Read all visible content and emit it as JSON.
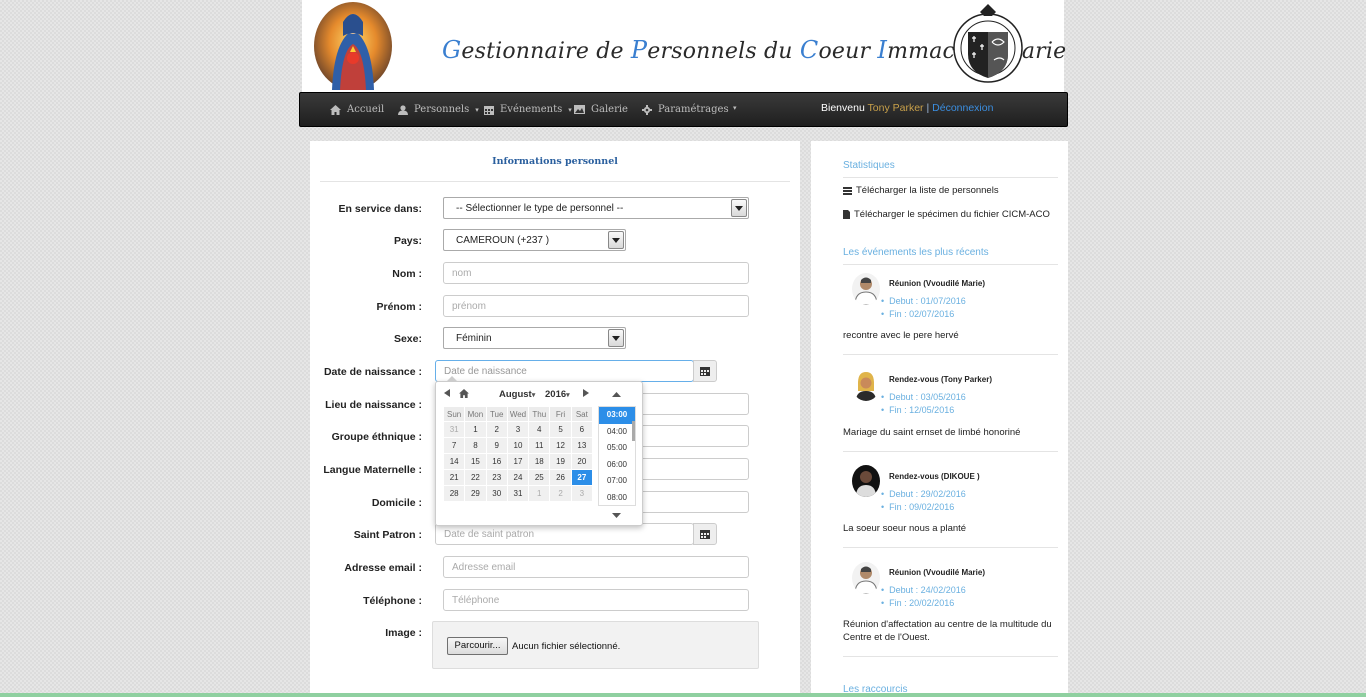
{
  "header": {
    "title_parts": [
      {
        "cap": "G",
        "rest": "estionnaire de "
      },
      {
        "cap": "P",
        "rest": "ersonnels du "
      },
      {
        "cap": "C",
        "rest": "oeur "
      },
      {
        "cap": "I",
        "rest": "mmaculé "
      },
      {
        "cap": "M",
        "rest": "arie"
      }
    ]
  },
  "nav": {
    "items": [
      {
        "label": "Accueil",
        "icon": "home-icon",
        "dropdown": false
      },
      {
        "label": "Personnels",
        "icon": "user-icon",
        "dropdown": true
      },
      {
        "label": "Evénements",
        "icon": "calendar-icon",
        "dropdown": true
      },
      {
        "label": "Galerie",
        "icon": "picture-icon",
        "dropdown": false
      },
      {
        "label": "Paramétrages",
        "icon": "gear-icon",
        "dropdown": false
      }
    ],
    "welcome": "Bienvenu",
    "user": "Tony Parker",
    "separator": "|",
    "logout": "Déconnexion"
  },
  "form": {
    "title": "Informations personnel",
    "fields": {
      "service_label": "En service dans:",
      "service_value": "-- Sélectionner le type de personnel --",
      "pays_label": "Pays:",
      "pays_value": "CAMEROUN (+237 )",
      "nom_label": "Nom :",
      "nom_placeholder": "nom",
      "prenom_label": "Prénom :",
      "prenom_placeholder": "prénom",
      "sexe_label": "Sexe:",
      "sexe_value": "Féminin",
      "naissance_label": "Date de naissance :",
      "naissance_placeholder": "Date de naissance",
      "lieu_label": "Lieu de naissance :",
      "ethnique_label": "Groupe éthnique :",
      "langue_label": "Langue Maternelle :",
      "domicile_label": "Domicile :",
      "patron_label": "Saint Patron :",
      "patron_placeholder": "Date de saint patron",
      "email_label": "Adresse email :",
      "email_placeholder": "Adresse email",
      "tel_label": "Téléphone :",
      "tel_placeholder": "Téléphone",
      "image_label": "Image :",
      "browse_label": "Parcourir...",
      "file_status": "Aucun fichier sélectionné."
    }
  },
  "datepicker": {
    "month": "August",
    "year": "2016",
    "weekdays": [
      "Sun",
      "Mon",
      "Tue",
      "Wed",
      "Thu",
      "Fri",
      "Sat"
    ],
    "weeks": [
      [
        {
          "d": "31",
          "m": true
        },
        {
          "d": "1"
        },
        {
          "d": "2"
        },
        {
          "d": "3"
        },
        {
          "d": "4"
        },
        {
          "d": "5"
        },
        {
          "d": "6"
        }
      ],
      [
        {
          "d": "7"
        },
        {
          "d": "8"
        },
        {
          "d": "9"
        },
        {
          "d": "10"
        },
        {
          "d": "11"
        },
        {
          "d": "12"
        },
        {
          "d": "13"
        }
      ],
      [
        {
          "d": "14"
        },
        {
          "d": "15"
        },
        {
          "d": "16"
        },
        {
          "d": "17"
        },
        {
          "d": "18"
        },
        {
          "d": "19"
        },
        {
          "d": "20"
        }
      ],
      [
        {
          "d": "21"
        },
        {
          "d": "22"
        },
        {
          "d": "23"
        },
        {
          "d": "24"
        },
        {
          "d": "25"
        },
        {
          "d": "26"
        },
        {
          "d": "27",
          "a": true
        }
      ],
      [
        {
          "d": "28"
        },
        {
          "d": "29"
        },
        {
          "d": "30"
        },
        {
          "d": "31"
        },
        {
          "d": "1",
          "m": true
        },
        {
          "d": "2",
          "m": true
        },
        {
          "d": "3",
          "m": true
        }
      ]
    ],
    "times": [
      "03:00",
      "04:00",
      "05:00",
      "06:00",
      "07:00",
      "08:00"
    ],
    "active_time": "03:00"
  },
  "sidebar": {
    "stats_title": "Statistiques",
    "download_list": "Télécharger la liste de personnels",
    "download_specimen": "Télécharger le spécimen du fichier CICM-ACO",
    "events_title": "Les événements les plus récents",
    "events": [
      {
        "title": "Réunion (Vvoudilé Marie)",
        "debut": "Debut : 01/07/2016",
        "fin": "Fin : 02/07/2016",
        "desc": "recontre avec le pere hervé"
      },
      {
        "title": "Rendez-vous (Tony Parker)",
        "debut": "Debut : 03/05/2016",
        "fin": "Fin : 12/05/2016",
        "desc": "Mariage du saint ernset de limbé honoriné"
      },
      {
        "title": "Rendez-vous (DIKOUE )",
        "debut": "Debut : 29/02/2016",
        "fin": "Fin : 09/02/2016",
        "desc": "La soeur soeur nous a planté"
      },
      {
        "title": "Réunion (Vvoudilé Marie)",
        "debut": "Debut : 24/02/2016",
        "fin": "Fin : 20/02/2016",
        "desc": "Réunion d'affectation au centre de la multitude du Centre et de l'Ouest."
      }
    ],
    "shortcuts_title": "Les raccourcis"
  },
  "colors": {
    "accent_blue": "#3a7fd0",
    "link_blue": "#6ab0e0",
    "active_blue": "#2c8ee8",
    "username_gold": "#c8a04a"
  }
}
